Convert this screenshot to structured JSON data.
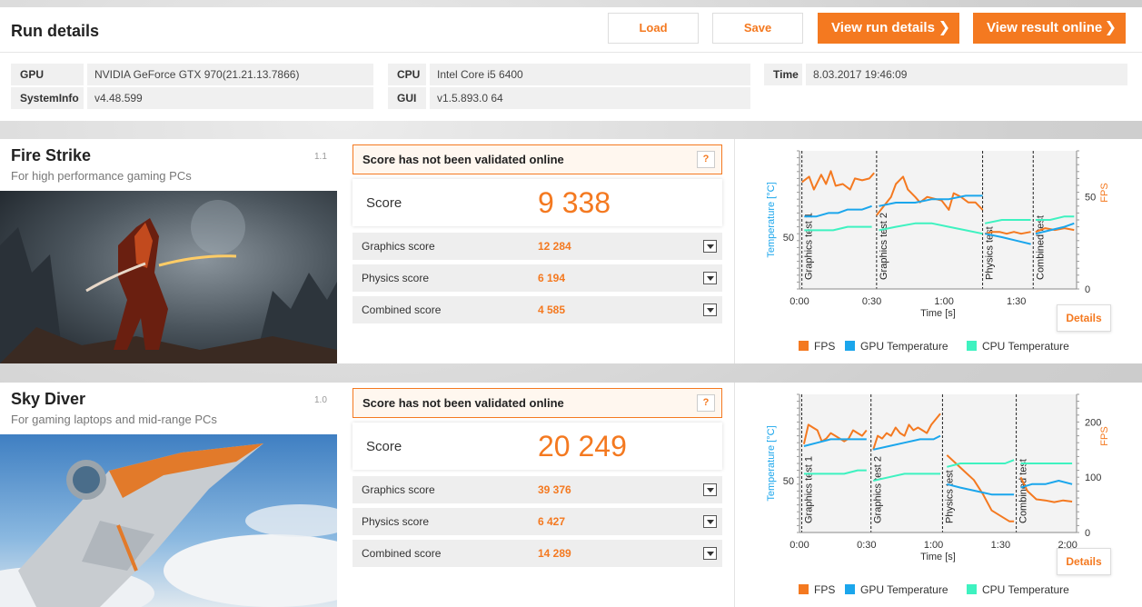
{
  "run": {
    "title": "Run details",
    "buttons": {
      "load": "Load",
      "save": "Save",
      "view_run": "View run details",
      "view_online": "View result online"
    },
    "gpu_label": "GPU",
    "gpu_value": "NVIDIA GeForce GTX 970(21.21.13.7866)",
    "sysinfo_label": "SystemInfo",
    "sysinfo_value": "v4.48.599",
    "cpu_label": "CPU",
    "cpu_value": "Intel Core i5 6400",
    "gui_label": "GUI",
    "gui_value": "v1.5.893.0 64",
    "time_label": "Time",
    "time_value": "8.03.2017 19:46:09"
  },
  "colors": {
    "accent": "#f47920",
    "fps": "#f47920",
    "gpu_temp": "#1ba6ec",
    "cpu_temp": "#3ef2c0"
  },
  "benchmarks": [
    {
      "name": "Fire Strike",
      "version": "1.1",
      "subtitle": "For high performance gaming PCs",
      "validation": "Score has not been validated online",
      "help": "?",
      "score_label": "Score",
      "score": "9 338",
      "subscores": [
        {
          "label": "Graphics score",
          "value": "12 284"
        },
        {
          "label": "Physics score",
          "value": "6 194"
        },
        {
          "label": "Combined score",
          "value": "4 585"
        }
      ],
      "details": "Details"
    },
    {
      "name": "Sky Diver",
      "version": "1.0",
      "subtitle": "For gaming laptops and mid-range PCs",
      "validation": "Score has not been validated online",
      "help": "?",
      "score_label": "Score",
      "score": "20 249",
      "subscores": [
        {
          "label": "Graphics score",
          "value": "39 376"
        },
        {
          "label": "Physics score",
          "value": "6 427"
        },
        {
          "label": "Combined score",
          "value": "14 289"
        }
      ],
      "details": "Details"
    }
  ],
  "legend": {
    "fps": "FPS",
    "gpu": "GPU Temperature",
    "cpu": "CPU Temperature"
  },
  "chart_data": [
    {
      "type": "line",
      "xlabel": "Time [s]",
      "ylabel_left": "Temperature [°C]",
      "ylabel_right": "FPS",
      "x_ticks": [
        "0:00",
        "0:30",
        "1:00",
        "1:30"
      ],
      "y_left_ticks": [
        "50"
      ],
      "y_right_ticks": [
        "0",
        "50"
      ],
      "x_range": [
        0,
        115
      ],
      "y_left_range": [
        35,
        75
      ],
      "y_right_range": [
        0,
        75
      ],
      "sections": [
        {
          "name": "Graphics test 1",
          "start": 1,
          "end": 32
        },
        {
          "name": "Graphics test 2",
          "start": 32,
          "end": 76
        },
        {
          "name": "Physics test",
          "start": 76,
          "end": 97
        },
        {
          "name": "Combined test",
          "start": 97,
          "end": 115
        }
      ],
      "series": [
        {
          "name": "FPS",
          "axis": "right",
          "segments": [
            [
              [
                1,
                58
              ],
              [
                4,
                61
              ],
              [
                6,
                54
              ],
              [
                9,
                62
              ],
              [
                11,
                57
              ],
              [
                13,
                64
              ],
              [
                15,
                56
              ],
              [
                18,
                57
              ],
              [
                21,
                54
              ],
              [
                23,
                60
              ],
              [
                26,
                59
              ],
              [
                29,
                60
              ],
              [
                31,
                63
              ]
            ],
            [
              [
                32,
                40
              ],
              [
                35,
                45
              ],
              [
                38,
                50
              ],
              [
                40,
                57
              ],
              [
                43,
                61
              ],
              [
                45,
                54
              ],
              [
                48,
                50
              ],
              [
                50,
                47
              ],
              [
                53,
                50
              ],
              [
                56,
                49
              ],
              [
                59,
                48
              ],
              [
                62,
                43
              ],
              [
                64,
                52
              ],
              [
                67,
                50
              ],
              [
                70,
                47
              ],
              [
                73,
                47
              ],
              [
                76,
                43
              ]
            ],
            [
              [
                77,
                30
              ],
              [
                80,
                31
              ],
              [
                83,
                31
              ],
              [
                86,
                30
              ],
              [
                89,
                31
              ],
              [
                92,
                30
              ],
              [
                96,
                31
              ]
            ],
            [
              [
                98,
                31
              ],
              [
                102,
                33
              ],
              [
                106,
                32
              ],
              [
                110,
                33
              ],
              [
                114,
                32
              ]
            ]
          ]
        },
        {
          "name": "GPU Temperature",
          "axis": "left",
          "segments": [
            [
              [
                2,
                56
              ],
              [
                7,
                56
              ],
              [
                12,
                57
              ],
              [
                16,
                57
              ],
              [
                20,
                58
              ],
              [
                23,
                58
              ],
              [
                26,
                58
              ],
              [
                30,
                59
              ]
            ],
            [
              [
                33,
                59
              ],
              [
                40,
                60
              ],
              [
                48,
                60
              ],
              [
                55,
                61
              ],
              [
                62,
                61
              ],
              [
                69,
                62
              ],
              [
                76,
                62
              ]
            ],
            [
              [
                77,
                51
              ],
              [
                84,
                50
              ],
              [
                90,
                49
              ],
              [
                96,
                48
              ]
            ],
            [
              [
                98,
                51
              ],
              [
                104,
                52
              ],
              [
                110,
                53
              ],
              [
                114,
                54
              ]
            ]
          ]
        },
        {
          "name": "CPU Temperature",
          "axis": "left",
          "segments": [
            [
              [
                2,
                52
              ],
              [
                8,
                52
              ],
              [
                14,
                52
              ],
              [
                20,
                53
              ],
              [
                26,
                53
              ],
              [
                30,
                53
              ]
            ],
            [
              [
                33,
                52
              ],
              [
                40,
                53
              ],
              [
                48,
                54
              ],
              [
                55,
                54
              ],
              [
                62,
                53
              ],
              [
                69,
                52
              ],
              [
                76,
                51
              ]
            ],
            [
              [
                77,
                54
              ],
              [
                84,
                55
              ],
              [
                90,
                55
              ],
              [
                96,
                55
              ]
            ],
            [
              [
                98,
                55
              ],
              [
                104,
                55
              ],
              [
                110,
                56
              ],
              [
                114,
                56
              ]
            ]
          ]
        }
      ]
    },
    {
      "type": "line",
      "xlabel": "Time [s]",
      "ylabel_left": "Temperature [°C]",
      "ylabel_right": "FPS",
      "x_ticks": [
        "0:00",
        "0:30",
        "1:00",
        "1:30",
        "2:00"
      ],
      "y_left_ticks": [
        "50"
      ],
      "y_right_ticks": [
        "0",
        "100",
        "200"
      ],
      "x_range": [
        0,
        124
      ],
      "y_left_range": [
        35,
        75
      ],
      "y_right_range": [
        0,
        250
      ],
      "sections": [
        {
          "name": "Graphics test 1",
          "start": 1,
          "end": 32
        },
        {
          "name": "Graphics test 2",
          "start": 32,
          "end": 64
        },
        {
          "name": "Physics test",
          "start": 64,
          "end": 97
        },
        {
          "name": "Combined test",
          "start": 97,
          "end": 124
        }
      ],
      "series": [
        {
          "name": "FPS",
          "axis": "right",
          "segments": [
            [
              [
                2,
                160
              ],
              [
                4,
                195
              ],
              [
                6,
                190
              ],
              [
                8,
                185
              ],
              [
                10,
                165
              ],
              [
                12,
                170
              ],
              [
                14,
                180
              ],
              [
                16,
                175
              ],
              [
                18,
                170
              ],
              [
                20,
                165
              ],
              [
                22,
                170
              ],
              [
                24,
                185
              ],
              [
                26,
                180
              ],
              [
                28,
                175
              ],
              [
                30,
                185
              ]
            ],
            [
              [
                33,
                150
              ],
              [
                35,
                175
              ],
              [
                37,
                170
              ],
              [
                39,
                180
              ],
              [
                41,
                175
              ],
              [
                43,
                190
              ],
              [
                45,
                180
              ],
              [
                47,
                175
              ],
              [
                49,
                195
              ],
              [
                51,
                185
              ],
              [
                53,
                190
              ],
              [
                55,
                185
              ],
              [
                57,
                180
              ],
              [
                59,
                195
              ],
              [
                61,
                205
              ],
              [
                63,
                215
              ]
            ],
            [
              [
                66,
                140
              ],
              [
                70,
                125
              ],
              [
                74,
                110
              ],
              [
                78,
                95
              ],
              [
                82,
                70
              ],
              [
                86,
                40
              ],
              [
                90,
                30
              ],
              [
                94,
                20
              ],
              [
                96,
                20
              ]
            ],
            [
              [
                99,
                100
              ],
              [
                102,
                75
              ],
              [
                106,
                60
              ],
              [
                110,
                58
              ],
              [
                114,
                55
              ],
              [
                118,
                58
              ],
              [
                122,
                56
              ]
            ]
          ]
        },
        {
          "name": "GPU Temperature",
          "axis": "left",
          "segments": [
            [
              [
                2,
                60
              ],
              [
                8,
                61
              ],
              [
                14,
                62
              ],
              [
                20,
                62
              ],
              [
                26,
                62
              ],
              [
                30,
                62
              ]
            ],
            [
              [
                33,
                59
              ],
              [
                40,
                60
              ],
              [
                47,
                61
              ],
              [
                54,
                62
              ],
              [
                60,
                62
              ],
              [
                63,
                63
              ]
            ],
            [
              [
                66,
                49
              ],
              [
                72,
                48
              ],
              [
                79,
                47
              ],
              [
                86,
                46
              ],
              [
                92,
                46
              ],
              [
                96,
                46
              ]
            ],
            [
              [
                99,
                48
              ],
              [
                104,
                49
              ],
              [
                110,
                49
              ],
              [
                116,
                50
              ],
              [
                122,
                49
              ]
            ]
          ]
        },
        {
          "name": "CPU Temperature",
          "axis": "left",
          "segments": [
            [
              [
                2,
                52
              ],
              [
                8,
                52
              ],
              [
                14,
                52
              ],
              [
                20,
                52
              ],
              [
                26,
                53
              ],
              [
                30,
                53
              ]
            ],
            [
              [
                33,
                50
              ],
              [
                40,
                51
              ],
              [
                47,
                52
              ],
              [
                54,
                52
              ],
              [
                60,
                52
              ],
              [
                63,
                52
              ]
            ],
            [
              [
                66,
                54
              ],
              [
                72,
                55
              ],
              [
                79,
                55
              ],
              [
                86,
                55
              ],
              [
                92,
                55
              ],
              [
                96,
                56
              ]
            ],
            [
              [
                99,
                55
              ],
              [
                104,
                55
              ],
              [
                110,
                55
              ],
              [
                116,
                55
              ],
              [
                122,
                55
              ]
            ]
          ]
        }
      ]
    }
  ]
}
